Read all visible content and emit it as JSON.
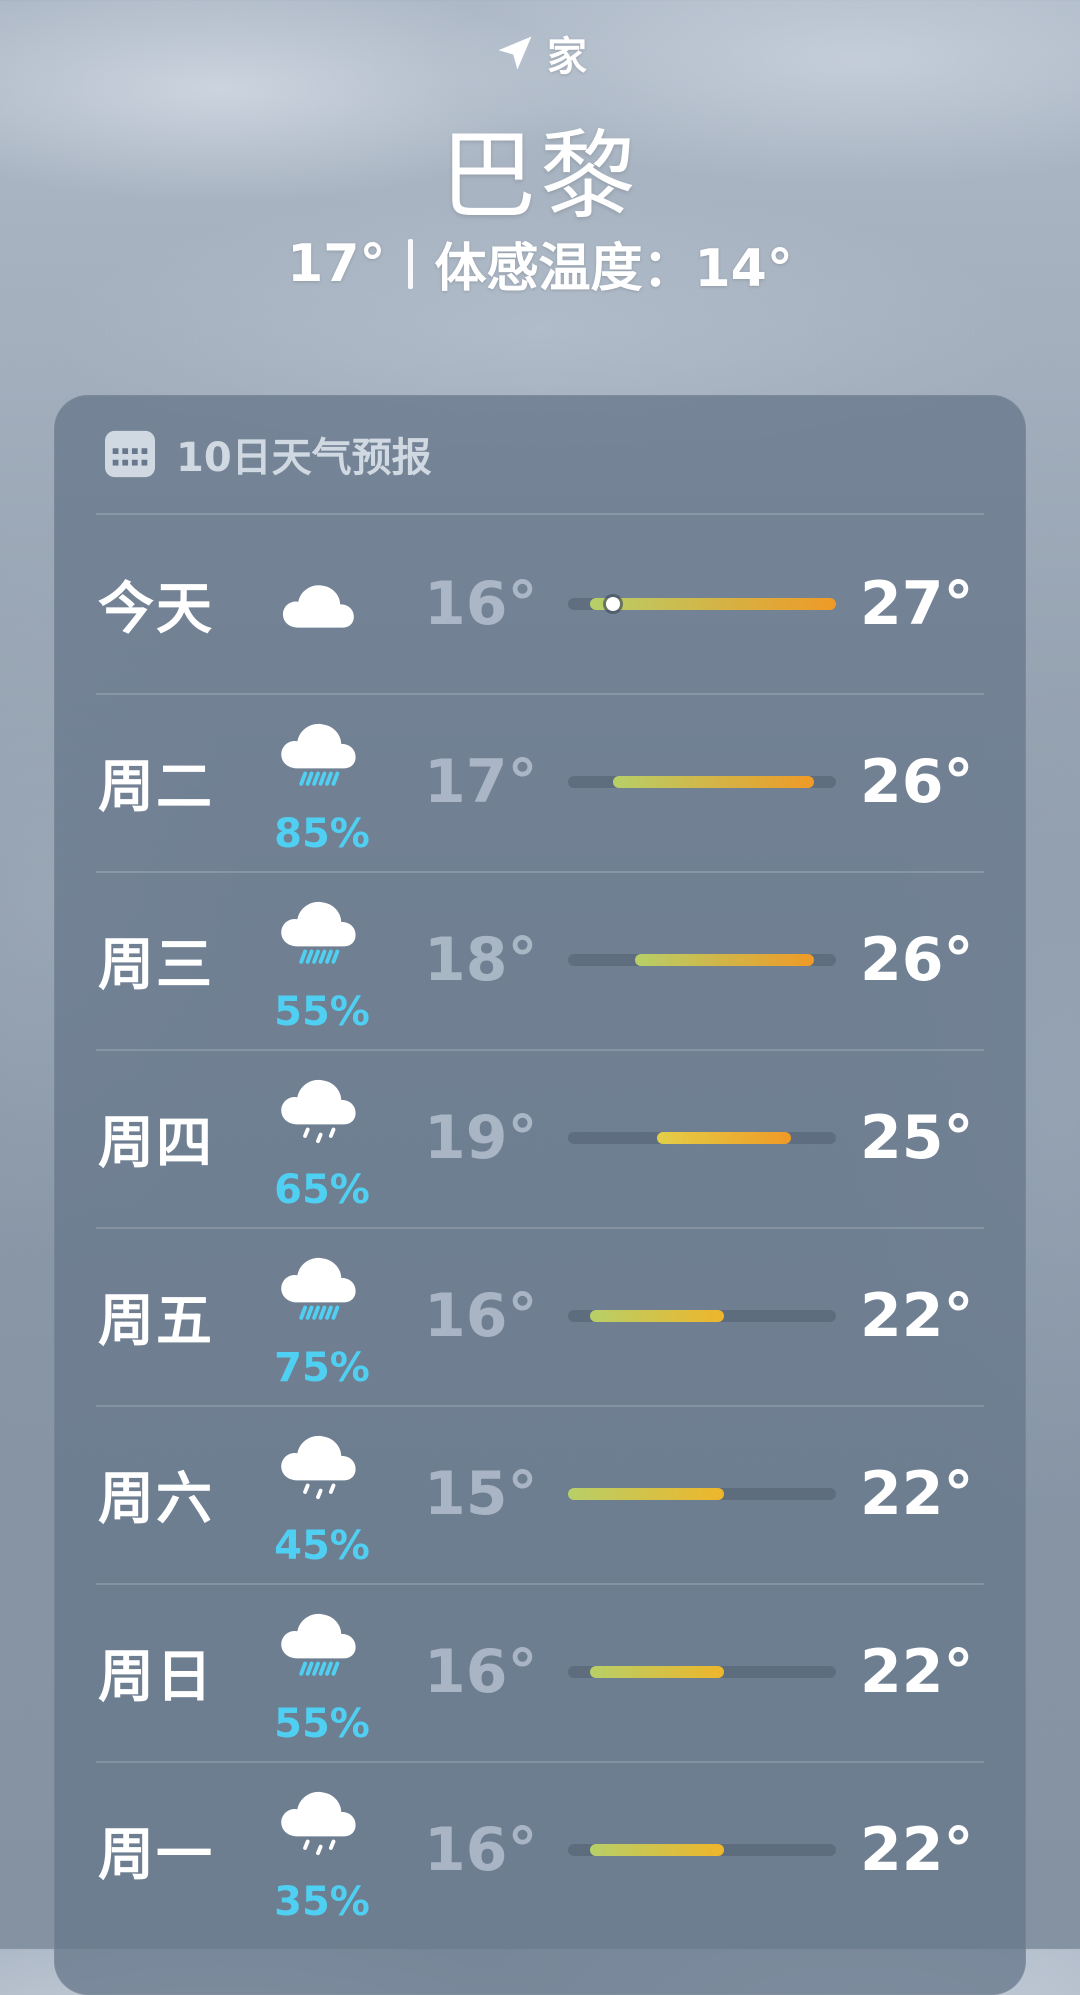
{
  "location": {
    "label": "家",
    "icon": "location-arrow-icon",
    "city": "巴黎",
    "current_temp": "17°",
    "feels_like": "体感温度：14°"
  },
  "forecast": {
    "title": "10日天气预报",
    "icon": "calendar-icon",
    "scale": {
      "min": 15,
      "max": 27
    },
    "current_temp_value": 17,
    "days": [
      {
        "day": "今天",
        "icon": "cloud-icon",
        "precip": "",
        "low": "16°",
        "high": "27°",
        "low_value": 16,
        "high_value": 27,
        "show_now": true
      },
      {
        "day": "周二",
        "icon": "cloud-rain-icon",
        "precip": "85%",
        "low": "17°",
        "high": "26°",
        "low_value": 17,
        "high_value": 26,
        "show_now": false
      },
      {
        "day": "周三",
        "icon": "cloud-rain-icon",
        "precip": "55%",
        "low": "18°",
        "high": "26°",
        "low_value": 18,
        "high_value": 26,
        "show_now": false
      },
      {
        "day": "周四",
        "icon": "cloud-drizzle-icon",
        "precip": "65%",
        "low": "19°",
        "high": "25°",
        "low_value": 19,
        "high_value": 25,
        "show_now": false
      },
      {
        "day": "周五",
        "icon": "cloud-rain-icon",
        "precip": "75%",
        "low": "16°",
        "high": "22°",
        "low_value": 16,
        "high_value": 22,
        "show_now": false
      },
      {
        "day": "周六",
        "icon": "cloud-drizzle-icon",
        "precip": "45%",
        "low": "15°",
        "high": "22°",
        "low_value": 15,
        "high_value": 22,
        "show_now": false
      },
      {
        "day": "周日",
        "icon": "cloud-rain-icon",
        "precip": "55%",
        "low": "16°",
        "high": "22°",
        "low_value": 16,
        "high_value": 22,
        "show_now": false
      },
      {
        "day": "周一",
        "icon": "cloud-drizzle-icon",
        "precip": "35%",
        "low": "16°",
        "high": "22°",
        "low_value": 16,
        "high_value": 22,
        "show_now": false
      }
    ]
  },
  "colors": {
    "precip": "#4fd0f2",
    "cool": "#b7cf68",
    "mild": "#e4cf48",
    "warm": "#eeb62a",
    "hot": "#ef9a26"
  }
}
